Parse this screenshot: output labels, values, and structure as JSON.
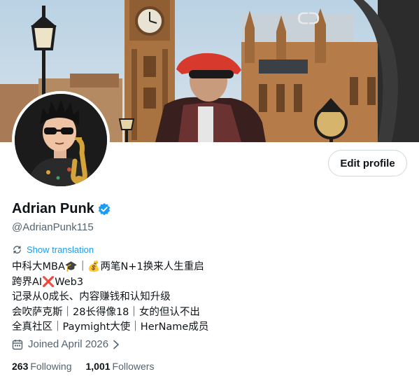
{
  "profile": {
    "display_name": "Adrian Punk",
    "handle": "@AdrianPunk115",
    "edit_profile_label": "Edit profile",
    "show_translation_label": "Show translation",
    "bio_lines": [
      "中科大MBA🎓｜💰两笔N+1换来人生重启",
      "跨界AI❌Web3",
      "记录从0成长、内容赚钱和认知升级",
      "会吹萨克斯｜28长得像18｜女的但认不出",
      "全真社区｜Paymight大使｜HerName成员"
    ],
    "joined_label": "Joined April 2026",
    "following_count": "263",
    "following_label": "Following",
    "followers_count": "1,001",
    "followers_label": "Followers"
  },
  "icons": {
    "verified": "verified-badge-icon",
    "translate": "translate-icon",
    "calendar": "calendar-icon",
    "chevron": "chevron-right-icon"
  },
  "colors": {
    "accent": "#1d9bf0",
    "text_primary": "#0f1419",
    "text_secondary": "#536471",
    "border": "#cfd9de"
  }
}
